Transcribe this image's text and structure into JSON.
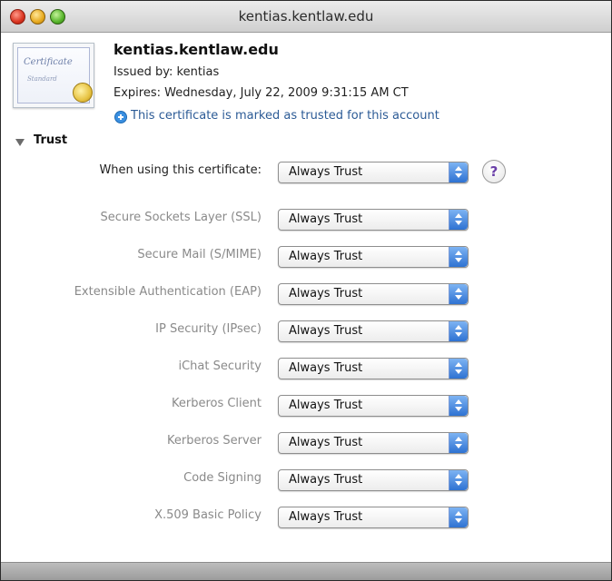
{
  "window": {
    "title": "kentias.kentlaw.edu"
  },
  "certificate": {
    "icon_text_1": "Certificate",
    "icon_text_2": "Standard",
    "name": "kentias.kentlaw.edu",
    "issued_by": "Issued by: kentias",
    "expires": "Expires: Wednesday, July 22, 2009 9:31:15 AM CT",
    "trusted_note": "This certificate is marked as trusted for this account"
  },
  "trust": {
    "section_label": "Trust",
    "help_label": "?",
    "main": {
      "label": "When using this certificate:",
      "value": "Always Trust"
    },
    "rows": [
      {
        "label": "Secure Sockets Layer (SSL)",
        "value": "Always Trust"
      },
      {
        "label": "Secure Mail (S/MIME)",
        "value": "Always Trust"
      },
      {
        "label": "Extensible Authentication (EAP)",
        "value": "Always Trust"
      },
      {
        "label": "IP Security (IPsec)",
        "value": "Always Trust"
      },
      {
        "label": "iChat Security",
        "value": "Always Trust"
      },
      {
        "label": "Kerberos Client",
        "value": "Always Trust"
      },
      {
        "label": "Kerberos Server",
        "value": "Always Trust"
      },
      {
        "label": "Code Signing",
        "value": "Always Trust"
      },
      {
        "label": "X.509 Basic Policy",
        "value": "Always Trust"
      }
    ]
  }
}
